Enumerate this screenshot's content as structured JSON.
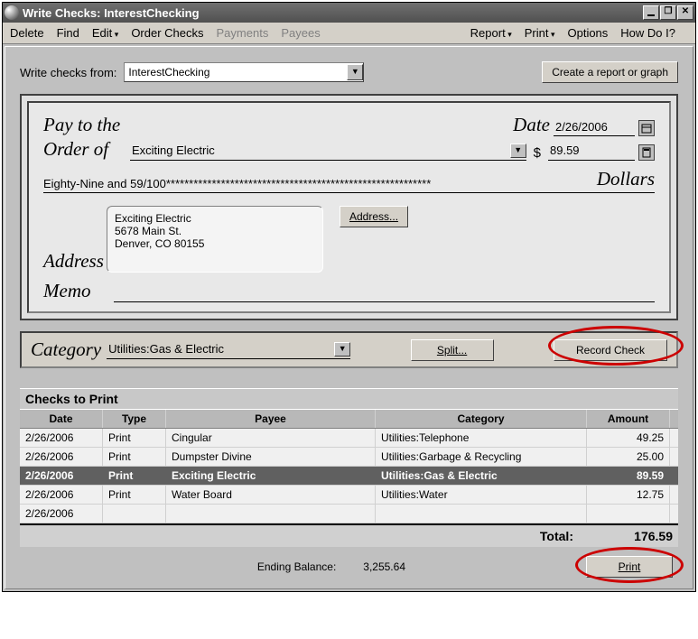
{
  "window_title": "Write Checks: InterestChecking",
  "menu": {
    "delete": "Delete",
    "find": "Find",
    "edit": "Edit",
    "order_checks": "Order Checks",
    "payments": "Payments",
    "payees": "Payees",
    "report": "Report",
    "print": "Print",
    "options": "Options",
    "howdoi": "How Do I?"
  },
  "toprow": {
    "label": "Write checks from:",
    "account_value": "InterestChecking",
    "report_btn": "Create a report or graph"
  },
  "check": {
    "payto_label1": "Pay to the",
    "payto_label2": "Order of",
    "payee": "Exciting Electric",
    "date_label": "Date",
    "date_value": "2/26/2006",
    "currency": "$",
    "amount": "89.59",
    "amount_words": "Eighty-Nine and 59/100**********************************************************",
    "dollars": "Dollars",
    "address_label": "Address",
    "address_text": "Exciting Electric\n5678 Main St.\nDenver, CO 80155",
    "address_btn": "Address...",
    "memo_label": "Memo",
    "memo_value": ""
  },
  "categoryrow": {
    "label": "Category",
    "value": "Utilities:Gas & Electric",
    "split_btn": "Split...",
    "record_btn": "Record Check"
  },
  "checks_to_print": {
    "title": "Checks to Print",
    "headers": {
      "date": "Date",
      "type": "Type",
      "payee": "Payee",
      "category": "Category",
      "amount": "Amount"
    },
    "rows": [
      {
        "date": "2/26/2006",
        "type": "Print",
        "payee": "Cingular",
        "category": "Utilities:Telephone",
        "amount": "49.25",
        "selected": false
      },
      {
        "date": "2/26/2006",
        "type": "Print",
        "payee": "Dumpster Divine",
        "category": "Utilities:Garbage & Recycling",
        "amount": "25.00",
        "selected": false
      },
      {
        "date": "2/26/2006",
        "type": "Print",
        "payee": "Exciting Electric",
        "category": "Utilities:Gas & Electric",
        "amount": "89.59",
        "selected": true
      },
      {
        "date": "2/26/2006",
        "type": "Print",
        "payee": "Water Board",
        "category": "Utilities:Water",
        "amount": "12.75",
        "selected": false
      },
      {
        "date": "2/26/2006",
        "type": "",
        "payee": "",
        "category": "",
        "amount": "",
        "selected": false
      }
    ],
    "total_label": "Total:",
    "total_value": "176.59"
  },
  "footer": {
    "balance_label": "Ending Balance:",
    "balance_value": "3,255.64",
    "print_btn": "Print"
  }
}
